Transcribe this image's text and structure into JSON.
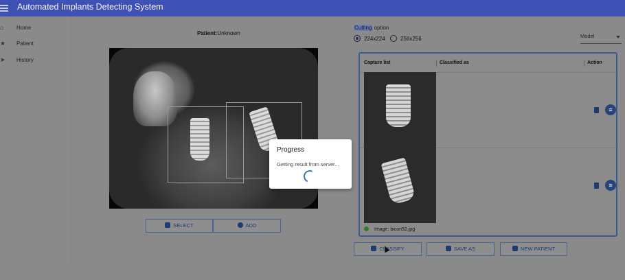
{
  "appbar": {
    "title": "Automated Implants Detecting System"
  },
  "sidebar": {
    "items": [
      {
        "label": "Home",
        "icon": "home-icon"
      },
      {
        "label": "Patient",
        "icon": "star-icon"
      },
      {
        "label": "History",
        "icon": "send-icon"
      }
    ]
  },
  "viewer": {
    "patient_label": "Patient:",
    "patient_value": "Unknown",
    "select_label": "SELECT",
    "add_label": "ADD"
  },
  "options": {
    "cutting_highlight": "Cutting",
    "cutting_rest": " option",
    "radio_1": "224x224",
    "radio_2": "256x256",
    "selected": "224x224",
    "model_label": "Model"
  },
  "capture": {
    "col_capture": "Capture list",
    "col_classified": "Classified as",
    "col_action": "Action",
    "status_text": "Image: bicon52.jpg",
    "status_color": "#2e7d32"
  },
  "actions": {
    "classify_label": "CLASSIFY",
    "save_as_label": "SAVE AS",
    "new_patient_label": "NEW PATIENT"
  },
  "dialog": {
    "title": "Progress",
    "text": "Getting result from server..."
  },
  "colors": {
    "appbar": "#3f51b5",
    "primary": "#1f3a6e",
    "accent": "#3f6fb5"
  }
}
